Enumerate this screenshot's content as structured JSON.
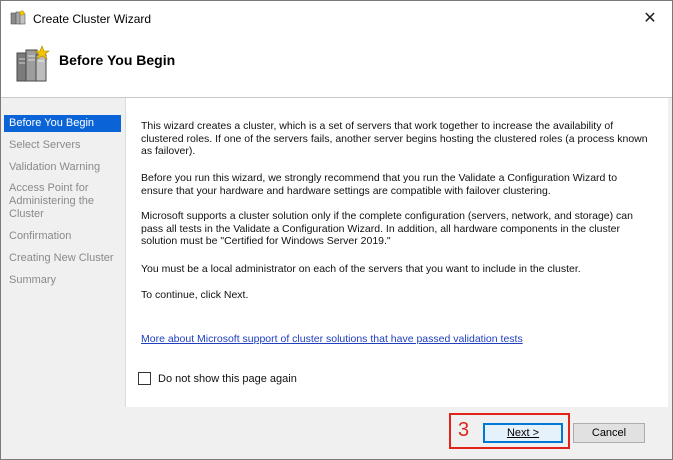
{
  "window": {
    "title": "Create Cluster Wizard"
  },
  "header": {
    "title": "Before You Begin"
  },
  "sidebar": {
    "items": [
      {
        "label": "Before You Begin",
        "active": true
      },
      {
        "label": "Select Servers"
      },
      {
        "label": "Validation Warning"
      },
      {
        "label": "Access Point for Administering the Cluster"
      },
      {
        "label": "Confirmation"
      },
      {
        "label": "Creating New Cluster"
      },
      {
        "label": "Summary"
      }
    ]
  },
  "content": {
    "paragraphs": [
      "This wizard creates a cluster, which is a set of servers that work together to increase the availability of clustered roles. If one of the servers fails, another server begins hosting the clustered roles (a process known as failover).",
      "Before you run this wizard, we strongly recommend that you run the Validate a Configuration Wizard to ensure that your hardware and hardware settings are compatible with failover clustering.",
      "Microsoft supports a cluster solution only if the complete configuration (servers, network, and storage) can pass all tests in the Validate a Configuration Wizard. In addition, all hardware components in the cluster solution must be \"Certified for Windows Server 2019.\"",
      "You must be a local administrator on each of the servers that you want to include in the cluster.",
      "To continue, click Next."
    ],
    "link": "More about Microsoft support of cluster solutions that have passed validation tests",
    "checkbox_label": "Do not show this page again",
    "checkbox_checked": false
  },
  "footer": {
    "annotation_number": "3",
    "next_label": "Next >",
    "cancel_label": "Cancel"
  },
  "colors": {
    "accent": "#0a64d8",
    "annotation": "#e0241b",
    "link": "#1f3fbf"
  }
}
